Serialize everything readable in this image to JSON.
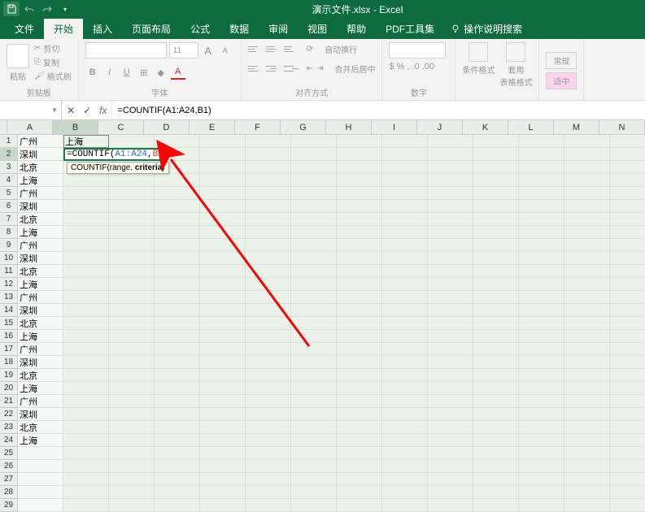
{
  "title": "演示文件.xlsx - Excel",
  "menu": {
    "file": "文件",
    "home": "开始",
    "insert": "插入",
    "layout": "页面布局",
    "formula": "公式",
    "data": "数据",
    "review": "审阅",
    "view": "视图",
    "help": "帮助",
    "pdf": "PDF工具集",
    "tell_me": "操作说明搜索"
  },
  "ribbon": {
    "clipboard": {
      "label": "剪贴板",
      "paste": "粘贴",
      "cut": "剪切",
      "copy": "复制",
      "brush": "格式刷"
    },
    "font": {
      "label": "字体",
      "size": "11",
      "big": "A",
      "small": "A",
      "bold": "B",
      "italic": "I",
      "underline": "U"
    },
    "align": {
      "label": "对齐方式",
      "wrap": "自动换行",
      "merge": "合并后居中"
    },
    "number": {
      "label": "数字",
      "general": "常规",
      "currency": "适中"
    },
    "styles": {
      "cond": "条件格式",
      "table": "套用\n表格格式"
    }
  },
  "formula_bar": {
    "name_box": "",
    "cancel": "✕",
    "confirm": "✓",
    "fx": "fx",
    "formula": "=COUNTIF(A1:A24,B1)"
  },
  "columns": [
    "A",
    "B",
    "C",
    "D",
    "E",
    "F",
    "G",
    "H",
    "I",
    "J",
    "K",
    "L",
    "M",
    "N"
  ],
  "col_a_data": [
    "广州",
    "深圳",
    "北京",
    "上海",
    "广州",
    "深圳",
    "北京",
    "上海",
    "广州",
    "深圳",
    "北京",
    "上海",
    "广州",
    "深圳",
    "北京",
    "上海",
    "广州",
    "深圳",
    "北京",
    "上海",
    "广州",
    "深圳",
    "北京",
    "上海"
  ],
  "b1_value": "上海",
  "b2_formula_display": {
    "prefix": "=COUNTIF",
    "lp": "(",
    "range": "A1:A24",
    "comma": ",",
    "crit": "B1",
    "rp": ")"
  },
  "tooltip": {
    "func": "COUNTIF(",
    "p1": "range, ",
    "p2": "criteria",
    "end": ")"
  },
  "row_count": 29
}
